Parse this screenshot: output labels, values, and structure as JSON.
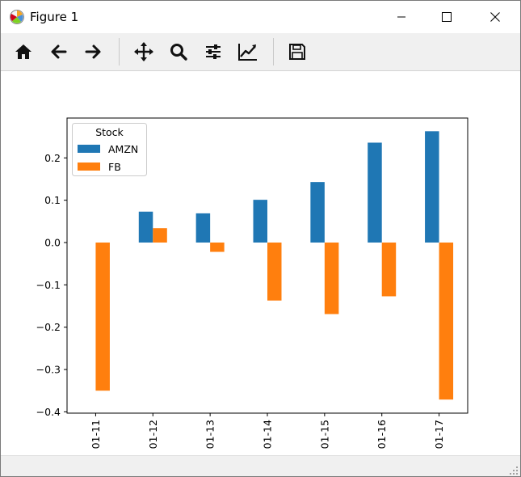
{
  "window": {
    "title": "Figure 1"
  },
  "toolbar": {
    "tools": [
      {
        "name": "home",
        "icon": "home-icon",
        "tooltip": "Reset original view"
      },
      {
        "name": "back",
        "icon": "arrow-left-icon",
        "tooltip": "Back to previous view"
      },
      {
        "name": "forward",
        "icon": "arrow-right-icon",
        "tooltip": "Forward to next view"
      },
      {
        "name": "pan",
        "icon": "move-icon",
        "tooltip": "Pan axes"
      },
      {
        "name": "zoom",
        "icon": "magnifier-icon",
        "tooltip": "Zoom to rectangle"
      },
      {
        "name": "subplots",
        "icon": "sliders-icon",
        "tooltip": "Configure subplots"
      },
      {
        "name": "customize",
        "icon": "line-chart-icon",
        "tooltip": "Edit axis"
      },
      {
        "name": "save",
        "icon": "floppy-disk-icon",
        "tooltip": "Save the figure"
      }
    ]
  },
  "chart_data": {
    "type": "bar",
    "categories": [
      "01-11",
      "01-12",
      "01-13",
      "01-14",
      "01-15",
      "01-16",
      "01-17"
    ],
    "series": [
      {
        "name": "AMZN",
        "color": "#1f77b4",
        "values": [
          0.0,
          0.073,
          0.069,
          0.101,
          0.143,
          0.236,
          0.263
        ]
      },
      {
        "name": "FB",
        "color": "#ff7f0e",
        "values": [
          -0.35,
          0.034,
          -0.022,
          -0.137,
          -0.169,
          -0.127,
          -0.371
        ]
      }
    ],
    "ylim": [
      -0.4,
      0.29
    ],
    "yticks": [
      0.2,
      0.1,
      0.0,
      -0.1,
      -0.2,
      -0.3,
      -0.4
    ],
    "ytick_labels": [
      "0.2",
      "0.1",
      "0.0",
      "−0.1",
      "−0.2",
      "−0.3",
      "−0.4"
    ],
    "legend": {
      "title": "Stock",
      "placement": "top-left"
    },
    "title": "",
    "xlabel": "",
    "ylabel": "",
    "grid": false
  }
}
